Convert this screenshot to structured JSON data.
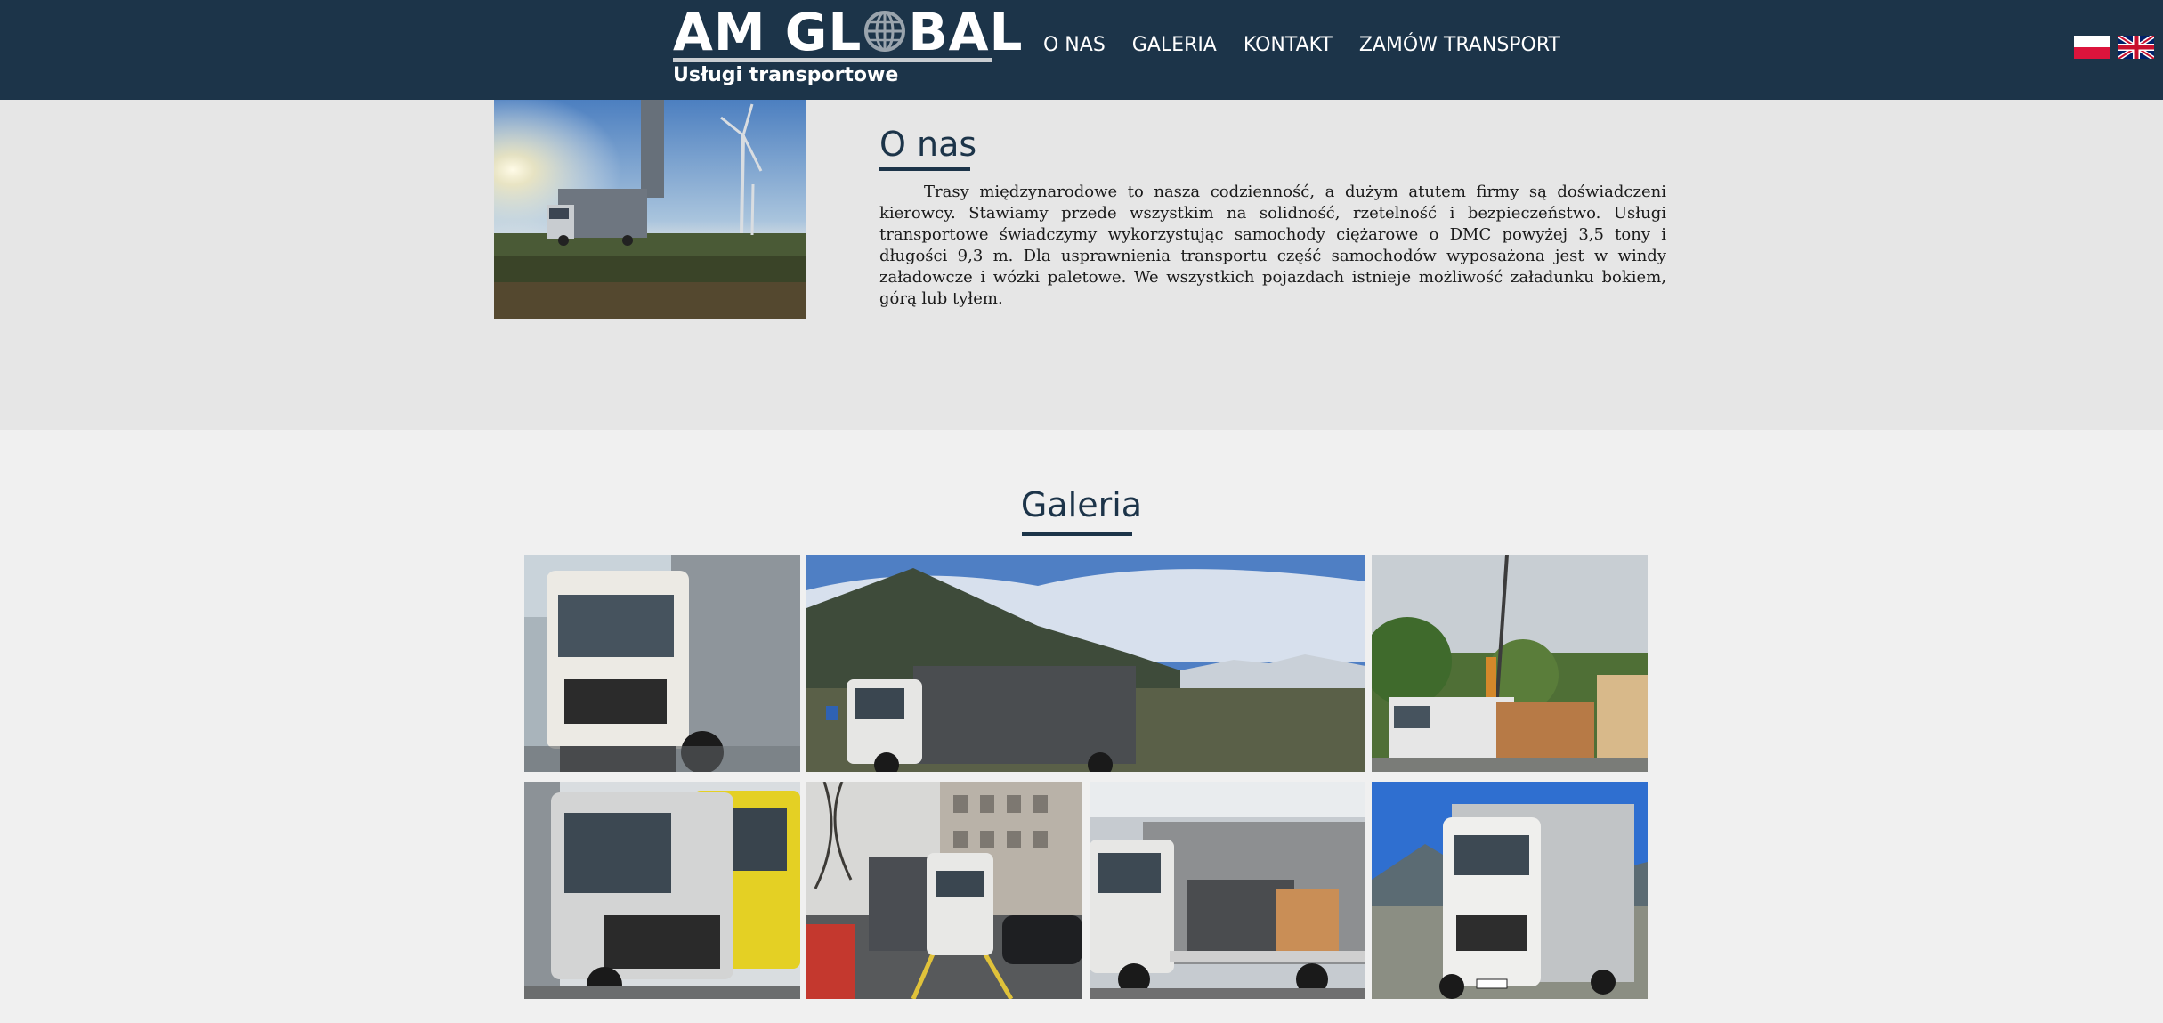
{
  "header": {
    "logo_title": "AM GL",
    "logo_title_end": "BAL",
    "logo_subtitle": "Usługi transportowe",
    "nav": [
      {
        "label": "O NAS"
      },
      {
        "label": "GALERIA"
      },
      {
        "label": "KONTAKT"
      },
      {
        "label": "ZAMÓW TRANSPORT"
      }
    ],
    "flags": [
      "polish-flag-icon",
      "uk-flag-icon"
    ],
    "background": "#1c3449"
  },
  "about": {
    "title": "O nas",
    "text": "Trasy międzynarodowe to nasza codzienność, a dużym atutem firmy są doświadczeni kierowcy. Stawiamy przede wszystkim na solidność, rzetelność i bezpieczeństwo. Usługi transportowe świadczymy wykorzystując samochody ciężarowe o DMC powyżej 3,5 tony i długości 9,3 m. Dla usprawnienia transportu część samochodów wyposażona jest w windy załadowcze i wózki paletowe. We wszystkich pojazdach istnieje możliwość załadunku bokiem, górą lub tyłem."
  },
  "gallery": {
    "title": "Galeria",
    "images": [
      "white-truck-front-photo",
      "truck-mountains-photo",
      "truck-crane-photo",
      "trucks-parked-photo",
      "truck-city-street-photo",
      "truck-loaded-crates-photo",
      "truck-mountain-road-photo"
    ]
  },
  "colors": {
    "brand_navy": "#1c3449",
    "about_bg": "#e6e6e6",
    "page_bg": "#f0f0f0"
  }
}
